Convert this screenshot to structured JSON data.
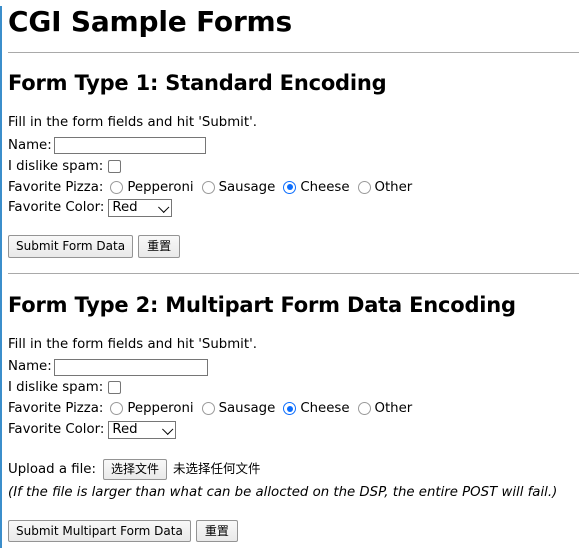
{
  "page": {
    "title": "CGI Sample Forms",
    "accent_border_color": "#3b8ecb",
    "rule_color": "#a9a9a9",
    "radio_selected_color": "#0d6efd"
  },
  "forms": [
    {
      "heading": "Form Type 1: Standard Encoding",
      "intro": "Fill in the form fields and hit 'Submit'.",
      "name_label": "Name:",
      "name_value": "",
      "name_placeholder": "",
      "spam_label": "I dislike spam:",
      "spam_checked": false,
      "pizza_label": "Favorite Pizza:",
      "pizza_options": [
        {
          "label": "Pepperoni",
          "selected": false
        },
        {
          "label": "Sausage",
          "selected": false
        },
        {
          "label": "Cheese",
          "selected": true
        },
        {
          "label": "Other",
          "selected": false
        }
      ],
      "color_label": "Favorite Color:",
      "color_value": "Red",
      "submit_label": "Submit Form Data",
      "reset_label": "重置"
    },
    {
      "heading": "Form Type 2: Multipart Form Data Encoding",
      "intro": "Fill in the form fields and hit 'Submit'.",
      "name_label": "Name:",
      "name_value": "",
      "name_placeholder": "",
      "spam_label": "I dislike spam:",
      "spam_checked": false,
      "pizza_label": "Favorite Pizza:",
      "pizza_options": [
        {
          "label": "Pepperoni",
          "selected": false
        },
        {
          "label": "Sausage",
          "selected": false
        },
        {
          "label": "Cheese",
          "selected": true
        },
        {
          "label": "Other",
          "selected": false
        }
      ],
      "color_label": "Favorite Color:",
      "color_value": "Red",
      "upload_label": "Upload a file:",
      "file_button_label": "选择文件",
      "file_status": "未选择任何文件",
      "note": "(If the file is larger than what can be allocted on the DSP, the entire POST will fail.)",
      "submit_label": "Submit Multipart Form Data",
      "reset_label": "重置"
    }
  ]
}
